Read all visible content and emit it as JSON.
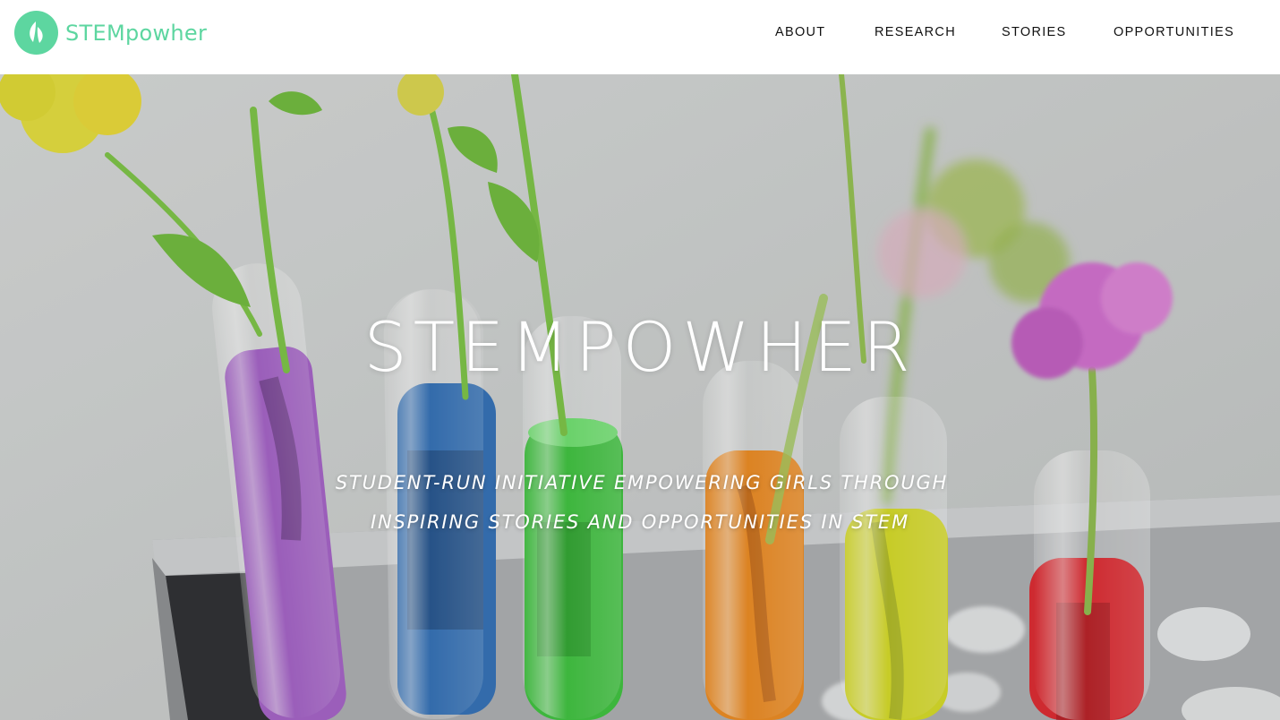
{
  "brand": {
    "logo_text": "STEMpowher",
    "logo_icon": "leaf-drop-icon",
    "accent_color": "#5dd6a0"
  },
  "nav": {
    "items": [
      {
        "label": "ABOUT"
      },
      {
        "label": "RESEARCH"
      },
      {
        "label": "STORIES"
      },
      {
        "label": "OPPORTUNITIES"
      }
    ]
  },
  "hero": {
    "title": "STEMPOWHER",
    "tagline_line1": "STUDENT-RUN INITIATIVE EMPOWERING GIRLS THROUGH",
    "tagline_line2": "INSPIRING STORIES AND OPPORTUNITIES IN STEM",
    "tube_colors": [
      "#a560c9",
      "#2f6fb8",
      "#3bc43b",
      "#f08a1c",
      "#d8dd22",
      "#e0252c"
    ]
  }
}
